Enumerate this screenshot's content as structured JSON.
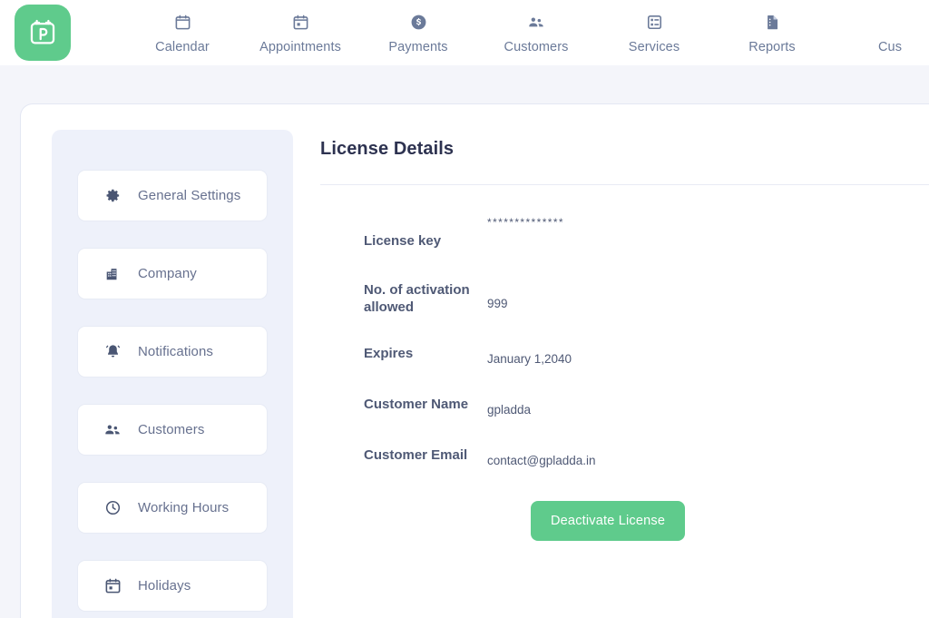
{
  "app": {
    "logo_icon": "calendar-p-logo-icon",
    "brand_color": "#5fcb8c"
  },
  "topnav": {
    "items": [
      {
        "label": "Calendar",
        "icon": "calendar-icon"
      },
      {
        "label": "Appointments",
        "icon": "calendar-day-icon"
      },
      {
        "label": "Payments",
        "icon": "dollar-circle-icon"
      },
      {
        "label": "Customers",
        "icon": "people-icon"
      },
      {
        "label": "Services",
        "icon": "list-box-icon"
      },
      {
        "label": "Reports",
        "icon": "document-icon"
      },
      {
        "label": "Cus",
        "icon": "clipped-icon"
      }
    ]
  },
  "settings_nav": {
    "items": [
      {
        "label": "General Settings",
        "icon": "gear-icon"
      },
      {
        "label": "Company",
        "icon": "building-icon"
      },
      {
        "label": "Notifications",
        "icon": "bell-icon"
      },
      {
        "label": "Customers",
        "icon": "people-icon"
      },
      {
        "label": "Working Hours",
        "icon": "clock-icon"
      },
      {
        "label": "Holidays",
        "icon": "calendar-day-icon"
      }
    ]
  },
  "license": {
    "title": "License Details",
    "rows": [
      {
        "label": "License key",
        "value": "**************"
      },
      {
        "label": "No. of activation allowed",
        "value": "999"
      },
      {
        "label": "Expires",
        "value": "January 1,2040"
      },
      {
        "label": "Customer Name",
        "value": "gpladda"
      },
      {
        "label": "Customer Email",
        "value": "contact@gpladda.in"
      }
    ],
    "deactivate_label": "Deactivate License"
  }
}
